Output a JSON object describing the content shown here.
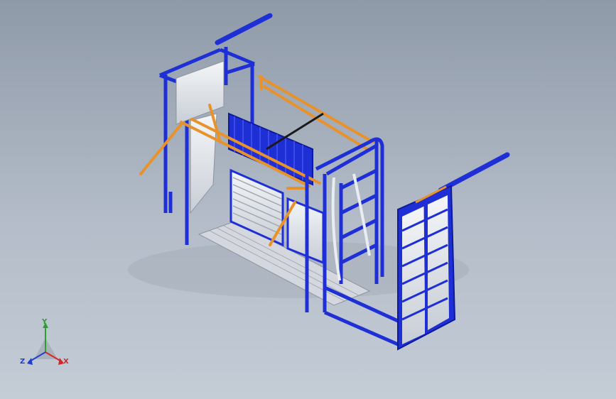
{
  "triad": {
    "x_label": "X",
    "y_label": "Y",
    "z_label": "Z"
  },
  "colors": {
    "background_top": "#8f9aa9",
    "background_bottom": "#c4ccd6",
    "frame_blue": "#1f2fd6",
    "frame_blue_dark": "#0d1a9a",
    "lever_orange": "#e8922c",
    "panel_white": "#e9ecf0",
    "panel_slat": "#b8bfc8",
    "floor_grate": "#d4d8de",
    "rod_dark": "#1a1a1a"
  }
}
